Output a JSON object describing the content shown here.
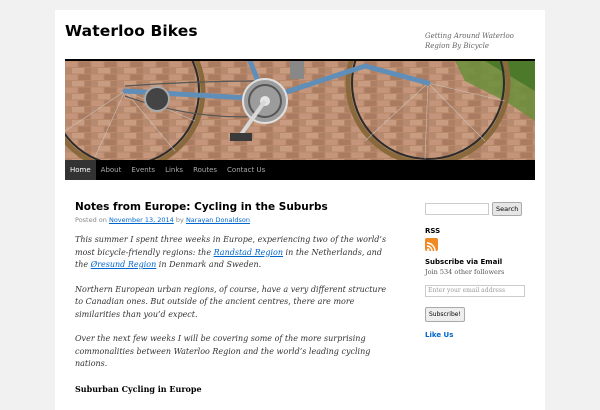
{
  "site": {
    "title": "Waterloo Bikes",
    "description": "Getting Around Waterloo Region By Bicycle"
  },
  "nav": {
    "items": [
      {
        "label": "Home",
        "current": true
      },
      {
        "label": "About",
        "current": false
      },
      {
        "label": "Events",
        "current": false
      },
      {
        "label": "Links",
        "current": false
      },
      {
        "label": "Routes",
        "current": false
      },
      {
        "label": "Contact Us",
        "current": false
      }
    ]
  },
  "post": {
    "title": "Notes from Europe: Cycling in the Suburbs",
    "meta_prefix": "Posted on",
    "date": "November 13, 2014",
    "meta_by": "by",
    "author": "Narayan Donaldson",
    "p1_a": "This summer I spent three weeks in Europe, experiencing two of the world’s most bicycle-friendly regions: the ",
    "p1_link1": "Randstad Region",
    "p1_b": " in the Netherlands, and the ",
    "p1_link2": "Øresund Region",
    "p1_c": " in Denmark and Sweden.",
    "p2": "Northern European urban regions, of course, have a very different structure to Canadian ones. But outside of the ancient centres, there are more similarities than you’d expect.",
    "p3": "Over the next few weeks I will be covering some of the more surprising commonalities between Waterloo Region and the world’s leading cycling nations.",
    "subheading": "Suburban Cycling in Europe"
  },
  "sidebar": {
    "search_button": "Search",
    "search_placeholder": "",
    "rss_title": "RSS",
    "subscribe_title": "Subscribe via Email",
    "subscribe_count": "Join 534 other followers",
    "email_placeholder": "Enter your email address",
    "subscribe_button": "Subscribe!",
    "like_title": "Like Us"
  },
  "colors": {
    "nav_bg": "#000000",
    "link": "#0066cc",
    "rss": "#f08a24"
  }
}
